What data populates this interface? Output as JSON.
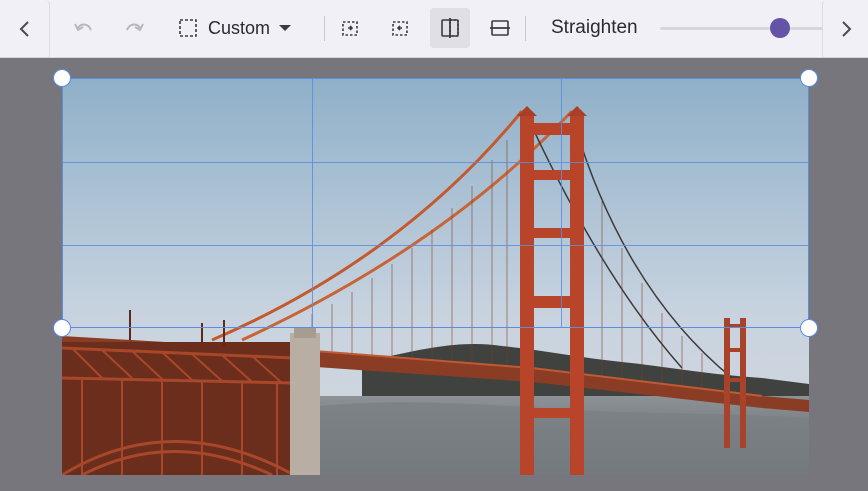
{
  "toolbar": {
    "aspect_ratio": {
      "label": "Custom",
      "icon": "crop-frame-icon",
      "dropdown_icon": "caret-down-icon"
    },
    "tools": [
      {
        "name": "undo",
        "icon": "undo-icon",
        "enabled": false
      },
      {
        "name": "redo",
        "icon": "redo-icon",
        "enabled": false
      },
      {
        "name": "rotate-left",
        "icon": "rotate-left-icon"
      },
      {
        "name": "rotate-right",
        "icon": "rotate-right-icon"
      },
      {
        "name": "flip-horizontal",
        "icon": "flip-horizontal-icon",
        "active": true
      },
      {
        "name": "flip-vertical",
        "icon": "flip-vertical-icon"
      }
    ],
    "straighten": {
      "label": "Straighten",
      "value_fraction": 0.72
    },
    "nav_prev_icon": "chevron-left-icon",
    "nav_next_icon": "chevron-right-icon"
  },
  "colors": {
    "toolbar_bg": "#f1f0f6",
    "accent": "#6553a8",
    "crop_guide": "#5b8de0",
    "workspace_bg": "#77767c"
  },
  "image": {
    "subject": "suspension bridge over fog",
    "crop_grid": "rule-of-thirds"
  }
}
